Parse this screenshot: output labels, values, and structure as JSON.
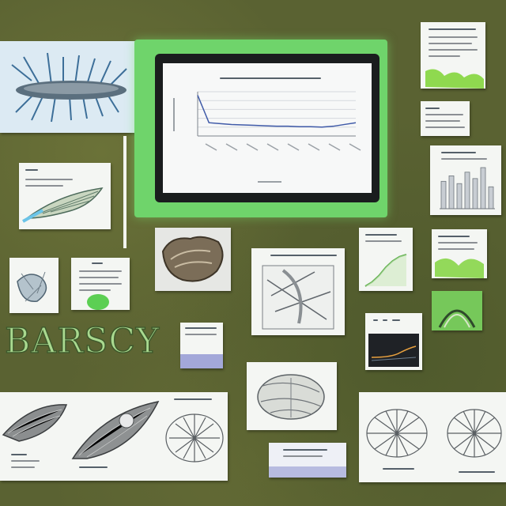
{
  "wordmark": {
    "text": "BARSCY"
  },
  "accent_colors": {
    "green": "#6fd46b",
    "board": "#5a6232",
    "paper": "#f4f6f3"
  },
  "monitor_chart": {
    "chart_data": {
      "type": "line",
      "series": [
        {
          "values": [
            92,
            30,
            28,
            26,
            25,
            24,
            23,
            22,
            22,
            21,
            21,
            20,
            22,
            26,
            30
          ]
        }
      ],
      "ylim": [
        0,
        100
      ],
      "grid": true
    }
  },
  "small_chart": {
    "chart_data": {
      "type": "line",
      "series": [
        {
          "values": [
            20,
            24,
            30,
            38,
            44,
            48,
            50
          ]
        }
      ]
    }
  },
  "bar_card": {
    "chart_data": {
      "type": "bar",
      "values": [
        60,
        72,
        55,
        80,
        66,
        90,
        48
      ]
    }
  }
}
